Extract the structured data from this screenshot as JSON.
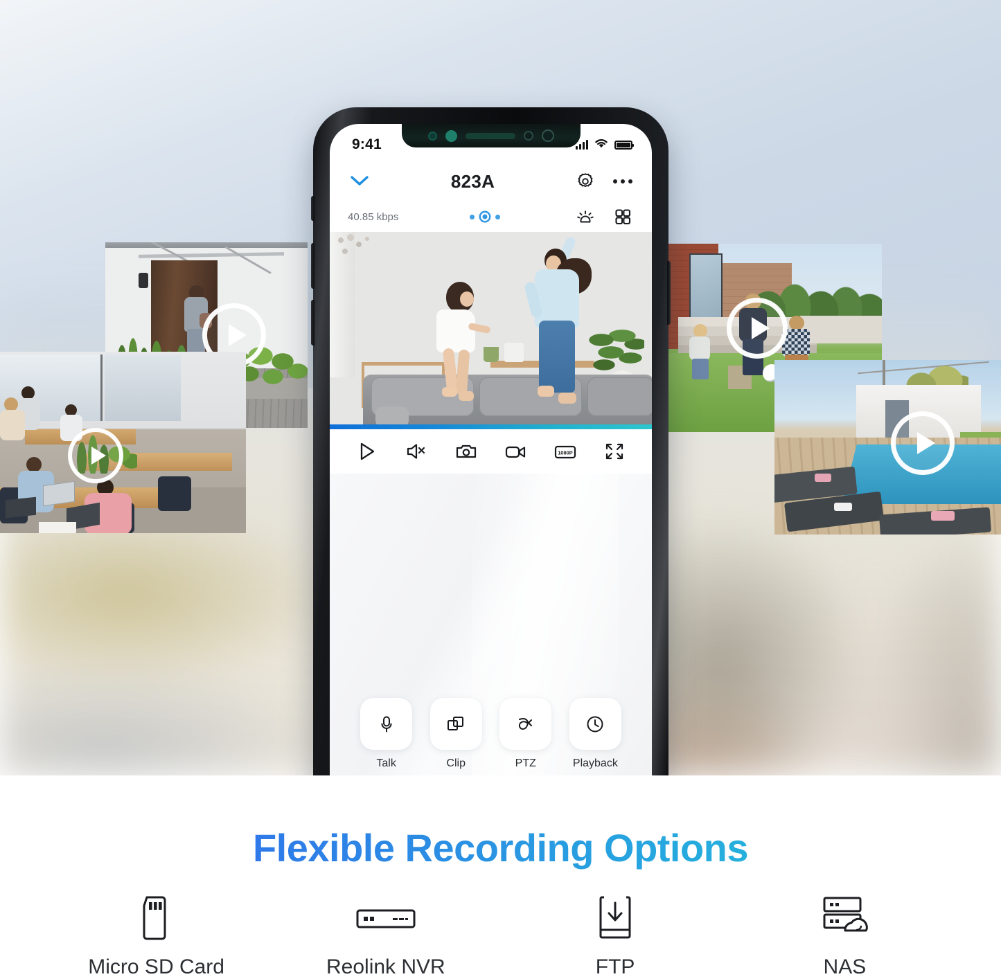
{
  "hero": {
    "background_top_color": "#ccd8e6",
    "background_bottom_color": "#e8e3d8",
    "collage_tiles": [
      {
        "name": "front-door-camera-clip",
        "scene": "Person unlocking front door on wooden deck",
        "has_play_button": true
      },
      {
        "name": "office-camera-clip",
        "scene": "Coworking office with people at wooden desks",
        "has_play_button": true
      },
      {
        "name": "backyard-camera-clip",
        "scene": "Father and child playing soccer on lawn",
        "has_play_button": true
      },
      {
        "name": "poolside-camera-clip",
        "scene": "Swimming pool with deck loungers",
        "has_play_button": true
      }
    ]
  },
  "phone": {
    "status_bar": {
      "time": "9:41",
      "signal_icon": "signal-bars-icon",
      "wifi_icon": "wifi-icon",
      "battery_icon": "battery-full-icon"
    },
    "header": {
      "back_icon": "chevron-down-icon",
      "title": "823A",
      "settings_icon": "gear-icon",
      "more_icon": "more-horizontal-icon"
    },
    "sub_bar": {
      "bitrate": "40.85 kbps",
      "page_dots": 3,
      "active_dot": 2,
      "siren_icon": "siren-alarm-icon",
      "grid_icon": "grid-view-icon",
      "dot_color": "#0f86dd"
    },
    "video": {
      "scene": "Mother and daughter jumping on living room couch",
      "accent_bar_from": "#0f6fd8",
      "accent_bar_to": "#2bc6cf"
    },
    "controls": [
      {
        "name": "play-button",
        "icon": "play-icon"
      },
      {
        "name": "mute-button",
        "icon": "speaker-muted-icon"
      },
      {
        "name": "snapshot-button",
        "icon": "camera-icon"
      },
      {
        "name": "record-button",
        "icon": "video-camera-icon"
      },
      {
        "name": "quality-button",
        "icon": "quality-1080p-icon",
        "label": "1080P"
      },
      {
        "name": "fullscreen-button",
        "icon": "fullscreen-icon"
      }
    ],
    "actions": [
      {
        "name": "talk-action",
        "label": "Talk",
        "icon": "microphone-icon"
      },
      {
        "name": "clip-action",
        "label": "Clip",
        "icon": "copy-clip-icon"
      },
      {
        "name": "ptz-action",
        "label": "PTZ",
        "icon": "ptz-icon"
      },
      {
        "name": "playback-action",
        "label": "Playback",
        "icon": "clock-icon"
      }
    ]
  },
  "footer": {
    "headline": "Flexible Recording Options",
    "headline_gradient_from": "#2f7ae8",
    "headline_gradient_to": "#22c9d6",
    "options": [
      {
        "name": "micro-sd-card-option",
        "label": "Micro SD Card",
        "icon": "micro-sd-card-icon"
      },
      {
        "name": "reolink-nvr-option",
        "label": "Reolink NVR",
        "icon": "nvr-box-icon"
      },
      {
        "name": "ftp-option",
        "label": "FTP",
        "icon": "ftp-download-icon"
      },
      {
        "name": "nas-option",
        "label": "NAS",
        "icon": "nas-cloud-server-icon"
      }
    ]
  }
}
